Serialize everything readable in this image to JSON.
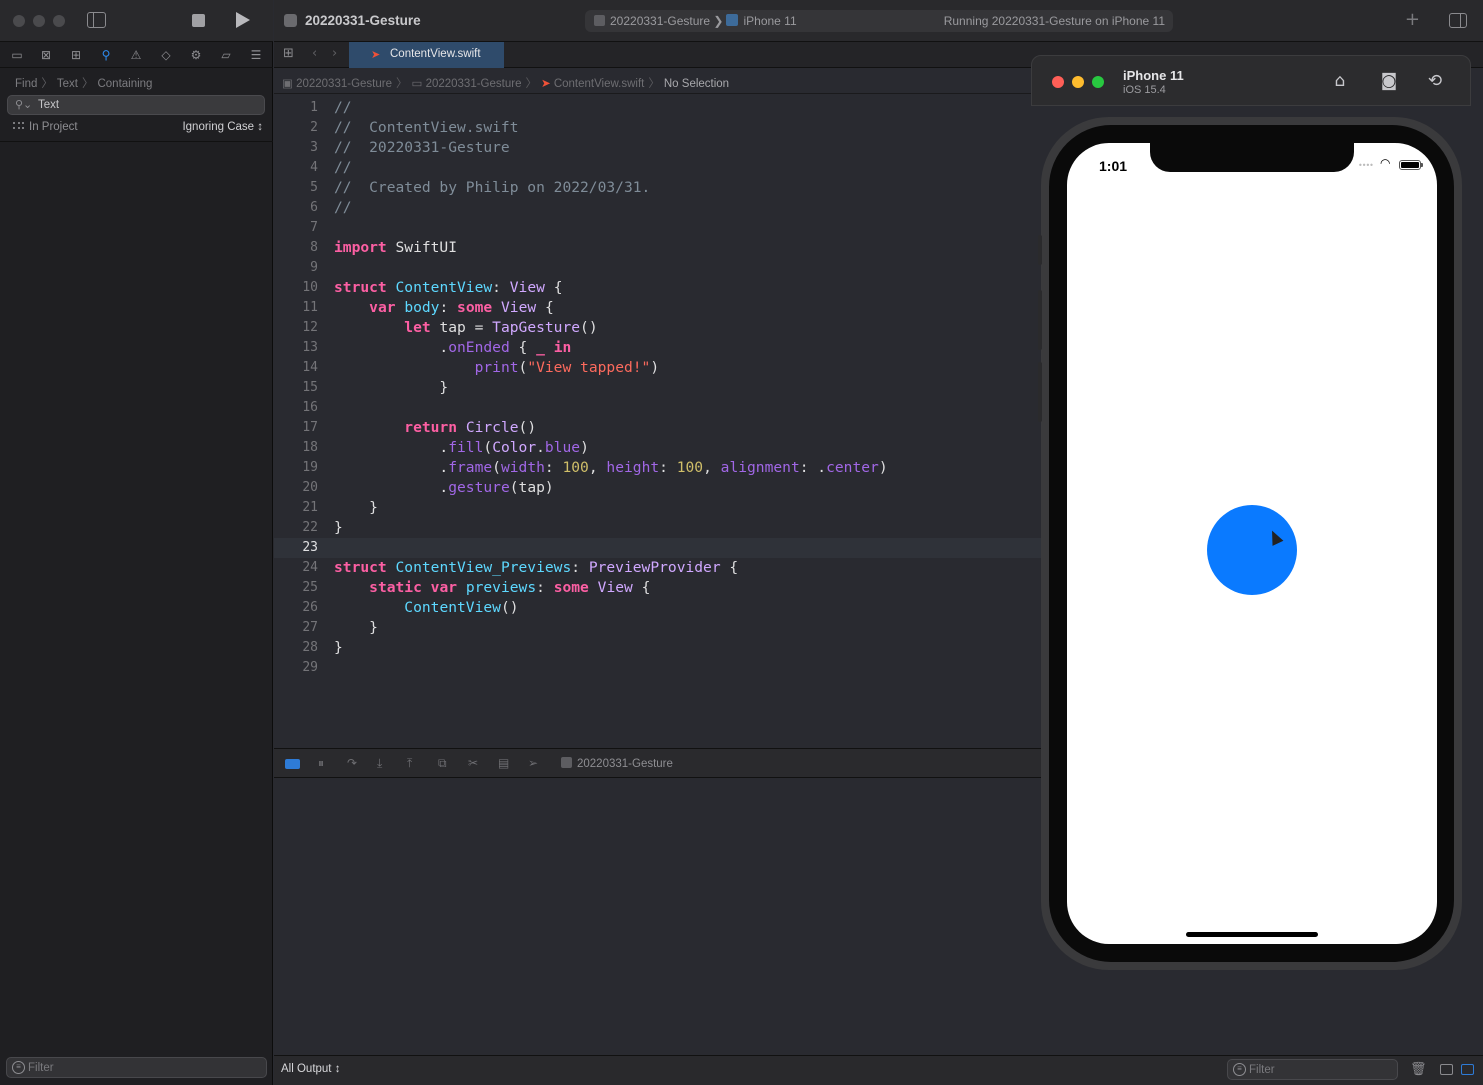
{
  "window": {
    "project_title": "20220331-Gesture",
    "scheme_target": "20220331-Gesture",
    "scheme_device": "iPhone 11",
    "run_status": "Running 20220331-Gesture on iPhone 11"
  },
  "navigator": {
    "find_breadcrumb": [
      "Find",
      "Text",
      "Containing"
    ],
    "search_value": "Text",
    "scope": "In Project",
    "case_option": "Ignoring Case ↕",
    "filter_placeholder": "Filter"
  },
  "editor": {
    "tab_label": "ContentView.swift",
    "jumpbar": [
      "20220331-Gesture",
      "20220331-Gesture",
      "ContentView.swift",
      "No Selection"
    ],
    "current_line": 23,
    "line_numbers": [
      "1",
      "2",
      "3",
      "4",
      "5",
      "6",
      "7",
      "8",
      "9",
      "10",
      "11",
      "12",
      "13",
      "14",
      "15",
      "16",
      "17",
      "18",
      "19",
      "20",
      "21",
      "22",
      "23",
      "24",
      "25",
      "26",
      "27",
      "28",
      "29"
    ]
  },
  "debug": {
    "process": "20220331-Gesture"
  },
  "console": {
    "output_selector": "All Output ↕",
    "filter_placeholder": "Filter"
  },
  "simulator": {
    "device_name": "iPhone 11",
    "os_version": "iOS 15.4",
    "status_time": "1:01",
    "circle_color": "#0a7aff"
  },
  "colors": {
    "accent": "#2d8cf0",
    "keyword": "#fc5fa3",
    "type": "#5dd8ff",
    "string": "#fc6a5d",
    "number": "#d0bf69",
    "comment": "#7f8c98"
  },
  "icons": [
    "sidebar-toggle-icon",
    "stop-icon",
    "run-icon",
    "folder-icon",
    "source-control-icon",
    "symbol-icon",
    "search-icon",
    "issue-icon",
    "test-icon",
    "debug-icon",
    "breakpoint-icon",
    "report-icon",
    "plus-icon",
    "inspector-toggle-icon",
    "home-icon",
    "screenshot-icon",
    "rotate-icon",
    "trash-icon"
  ]
}
